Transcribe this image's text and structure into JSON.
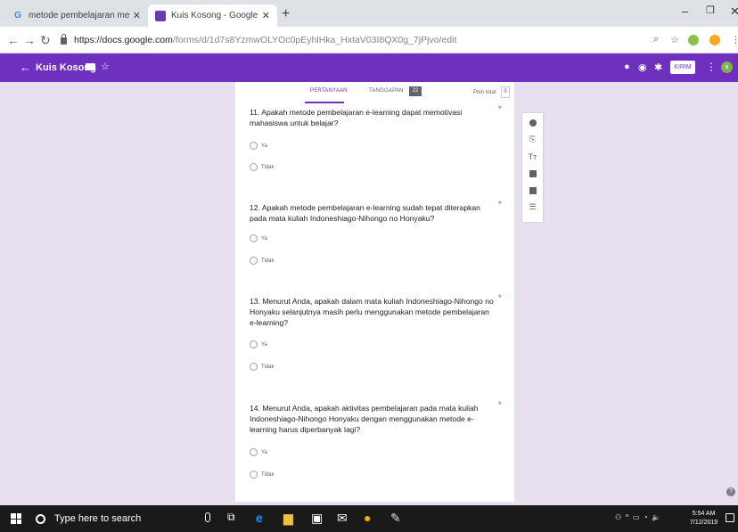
{
  "browser": {
    "tabs": [
      {
        "title": "metode pembelajaran menurut F",
        "icon": "google-icon"
      },
      {
        "title": "Kuis Kosong - Google Formulir",
        "icon": "forms-icon"
      }
    ],
    "url_host": "https://docs.google.com",
    "url_path": "/forms/d/1d7s8YzmwOLYOc0pEyhlHka_HxtaV03I8QX0g_7jPjvo/edit"
  },
  "form_header": {
    "title": "Kuis Kosong",
    "send_label": "KIRIM",
    "avatar_letter": "a",
    "accent_color": "#6f2fbf"
  },
  "tabs_bar": {
    "questions_label": "PERTANYAAN",
    "responses_label": "TANGGAPAN",
    "responses_count": "22",
    "points_label": "Poin total:",
    "points_value": "0"
  },
  "questions": [
    {
      "text": "11. Apakah metode pembelajaran e-learning dapat memotivasi mahasiswa untuk belajar?",
      "options": [
        "Ya",
        "Tidak"
      ],
      "required": true
    },
    {
      "text": "12. Apakah metode pembelajaran e-learning sudah tepat diterapkan pada mata kuliah Indoneshiago-Nihongo no Honyaku?",
      "options": [
        "Ya",
        "Tidak"
      ],
      "required": true
    },
    {
      "text": "13. Menurut Anda, apakah dalam mata kuliah Indoneshiago-Nihongo no Honyaku selanjutnya masih perlu menggunakan metode pembelajaran e-learning?",
      "options": [
        "Ya",
        "Tidak"
      ],
      "required": true
    },
    {
      "text": "14. Menurut Anda, apakah aktivitas pembelajaran pada mata kuliah Indoneshiago-Nihongo Honyaku dengan menggunakan metode e-learning harus diperbanyak lagi?",
      "options": [
        "Ya",
        "Tidak"
      ],
      "required": true
    }
  ],
  "taskbar": {
    "search_placeholder": "Type here to search",
    "time": "5:54 AM",
    "date": "7/12/2019"
  }
}
